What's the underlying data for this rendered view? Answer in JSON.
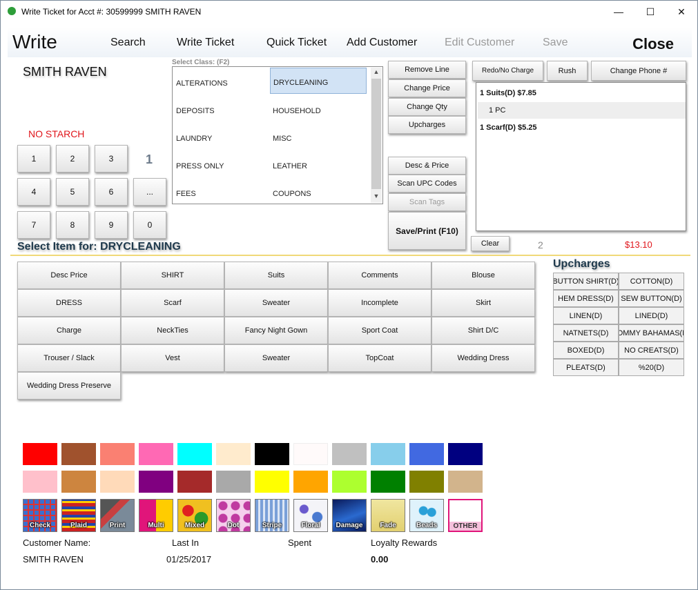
{
  "window": {
    "title": "Write Ticket for Acct #: 30599999  SMITH RAVEN",
    "minimize": "—",
    "maximize": "☐",
    "close": "✕"
  },
  "menu": {
    "write": "Write",
    "search": "Search",
    "write_ticket": "Write Ticket",
    "quick_ticket": "Quick Ticket",
    "add_customer": "Add Customer",
    "edit_customer": "Edit Customer",
    "save": "Save",
    "close": "Close"
  },
  "customer": {
    "name": "SMITH RAVEN",
    "note": "NO STARCH"
  },
  "keypad": [
    "1",
    "2",
    "3",
    "4",
    "5",
    "6",
    "...",
    "7",
    "8",
    "9",
    "0"
  ],
  "quantity": "1",
  "class_select": {
    "label": "Select Class: (F2)",
    "items": [
      "ALTERATIONS",
      "DRYCLEANING",
      "DEPOSITS",
      "HOUSEHOLD",
      "LAUNDRY",
      "MISC",
      "PRESS ONLY",
      "LEATHER",
      "FEES",
      "COUPONS"
    ],
    "selected": "DRYCLEANING",
    "scroll_up": "▲",
    "scroll_down": "▼"
  },
  "actions": {
    "remove_line": "Remove Line",
    "change_price": "Change Price",
    "change_qty": "Change Qty",
    "upcharges": "Upcharges",
    "desc_price": "Desc & Price",
    "scan_upc": "Scan UPC Codes",
    "scan_tags": "Scan Tags",
    "save_print": "Save/Print (F10)",
    "redo_no_charge": "Redo/No Charge",
    "rush": "Rush",
    "change_phone": "Change Phone #",
    "clear": "Clear"
  },
  "ticket": {
    "lines": [
      {
        "text": "1  Suits(D)  $7.85",
        "style": "bold"
      },
      {
        "text": "1 PC",
        "style": "alt"
      },
      {
        "text": "1  Scarf(D)  $5.25",
        "style": "bold"
      }
    ],
    "item_count": "2",
    "total": "$13.10"
  },
  "items": {
    "label": "Select Item for: DRYCLEANING",
    "buttons": [
      "Desc  Price",
      "SHIRT",
      "Suits",
      "Comments",
      "Blouse",
      "DRESS",
      "Scarf",
      "Sweater",
      "Incomplete",
      "Skirt",
      "Charge",
      "NeckTies",
      "Fancy Night Gown",
      "Sport Coat",
      "Shirt D/C",
      "Trouser / Slack",
      "Vest",
      "Sweater",
      "TopCoat",
      "Wedding Dress",
      "Wedding Dress Preserve"
    ]
  },
  "upcharges": {
    "label": "Upcharges",
    "buttons": [
      "BUTTON SHIRT(D)",
      "COTTON(D)",
      "HEM DRESS(D)",
      "SEW BUTTON(D)",
      "LINEN(D)",
      "LINED(D)",
      "NATNETS(D)",
      "TOMMY BAHAMAS(D)",
      "BOXED(D)",
      "NO CREATS(D)",
      "PLEATS(D)",
      "%20(D)"
    ]
  },
  "colors": {
    "row1": [
      "#ff0000",
      "#a0522d",
      "#fa8072",
      "#ff69b4",
      "#00ffff",
      "#ffebcd",
      "#000000",
      "#fffafa",
      "#c0c0c0",
      "#87ceeb",
      "#4169e1",
      "#000080"
    ],
    "row2": [
      "#ffc0cb",
      "#cd853f",
      "#ffdab9",
      "#800080",
      "#a52a2a",
      "#a9a9a9",
      "#ffff00",
      "#ffa500",
      "#adff2f",
      "#008000",
      "#808000",
      "#d2b48c"
    ]
  },
  "patterns": [
    {
      "label": "Check",
      "icon": "check-pattern"
    },
    {
      "label": "Plaid",
      "icon": "plaid-pattern"
    },
    {
      "label": "Print",
      "icon": "print-pattern"
    },
    {
      "label": "Multi",
      "icon": "multi-pattern"
    },
    {
      "label": "Mixed",
      "icon": "mixed-pattern"
    },
    {
      "label": "Dot",
      "icon": "dot-pattern"
    },
    {
      "label": "Stripe",
      "icon": "stripe-pattern"
    },
    {
      "label": "Floral",
      "icon": "floral-pattern"
    },
    {
      "label": "Damage",
      "icon": "damage-pattern"
    },
    {
      "label": "Fade",
      "icon": "fade-pattern"
    },
    {
      "label": "Beads",
      "icon": "beads-pattern"
    },
    {
      "label": "OTHER",
      "icon": "other-pattern"
    }
  ],
  "footer": {
    "customer_name_label": "Customer Name:",
    "last_in_label": "Last In",
    "spent_label": "Spent",
    "loyalty_label": "Loyalty Rewards",
    "customer_name": "SMITH RAVEN",
    "last_in": "01/25/2017",
    "spent": "",
    "loyalty": "0.00"
  }
}
